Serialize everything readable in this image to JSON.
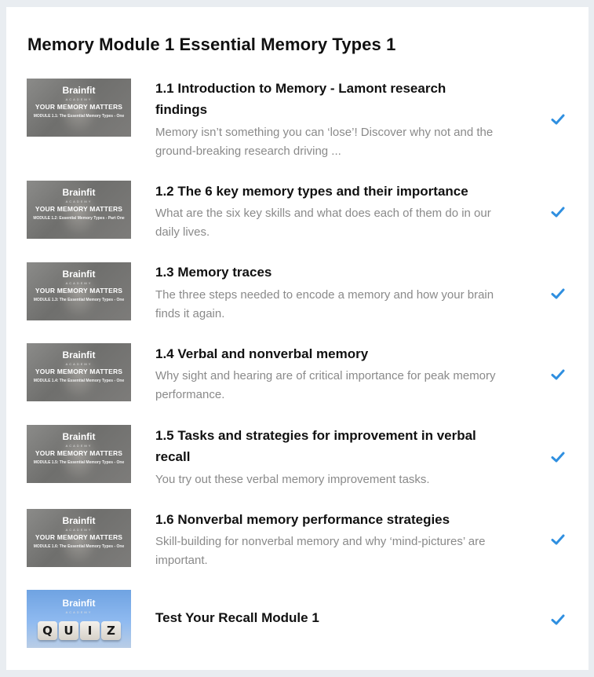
{
  "module": {
    "title": "Memory Module 1 Essential Memory Types 1"
  },
  "thumbnail": {
    "brand": "Brainfit",
    "academy": "ACADEMY",
    "headline": "YOUR MEMORY MATTERS"
  },
  "lessons": [
    {
      "title": "1.1 Introduction to Memory - Lamont research findings",
      "description": "Memory isn’t something you can ‘lose’! Discover why not and the ground-breaking research driving ...",
      "thumb_sub": "MODULE 1.1: The Essential Memory Types - One",
      "completed": true
    },
    {
      "title": "1.2 The 6 key memory types and their importance",
      "description": "What are the six key skills and what does each of them do in our daily lives.",
      "thumb_sub": "MODULE 1.2: Essential Memory Types - Part One",
      "completed": true
    },
    {
      "title": "1.3 Memory traces",
      "description": "The three steps needed to encode a memory and how your brain finds it again.",
      "thumb_sub": "MODULE 1.3: The Essential Memory Types - One",
      "completed": true
    },
    {
      "title": "1.4 Verbal and nonverbal memory",
      "description": "Why sight and hearing are of critical importance for peak memory performance.",
      "thumb_sub": "MODULE 1.4: The Essential Memory Types - One",
      "completed": true
    },
    {
      "title": "1.5 Tasks and strategies for improvement in verbal recall",
      "description": "You try out these verbal memory improvement tasks.",
      "thumb_sub": "MODULE 1.5: The Essential Memory Types - One",
      "completed": true
    },
    {
      "title": "1.6 Nonverbal memory performance strategies",
      "description": "Skill-building for nonverbal memory and why ‘mind-pictures’ are important.",
      "thumb_sub": "MODULE 1.6: The Essential Memory Types - One",
      "completed": true
    },
    {
      "title": "Test Your Recall Module 1",
      "description": "",
      "quiz_letters": [
        "Q",
        "U",
        "I",
        "Z"
      ],
      "completed": true
    }
  ],
  "colors": {
    "check": "#2f8fe0",
    "background": "#e9edf1",
    "card": "#ffffff"
  },
  "icons": {
    "completed": "check-icon"
  }
}
